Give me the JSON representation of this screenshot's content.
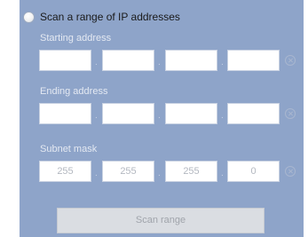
{
  "scan_range": {
    "radio_label": "Scan a range of IP addresses",
    "selected": false
  },
  "starting_address": {
    "label": "Starting address",
    "octets": [
      "",
      "",
      "",
      ""
    ]
  },
  "ending_address": {
    "label": "Ending address",
    "octets": [
      "",
      "",
      "",
      ""
    ]
  },
  "subnet_mask": {
    "label": "Subnet mask",
    "octets": [
      "255",
      "255",
      "255",
      "0"
    ]
  },
  "separator": ".",
  "scan_button": {
    "label": "Scan range",
    "enabled": false
  },
  "colors": {
    "panel_bg": "#8ea4c9",
    "field_bg": "#ffffff",
    "button_bg": "#dadde2"
  }
}
